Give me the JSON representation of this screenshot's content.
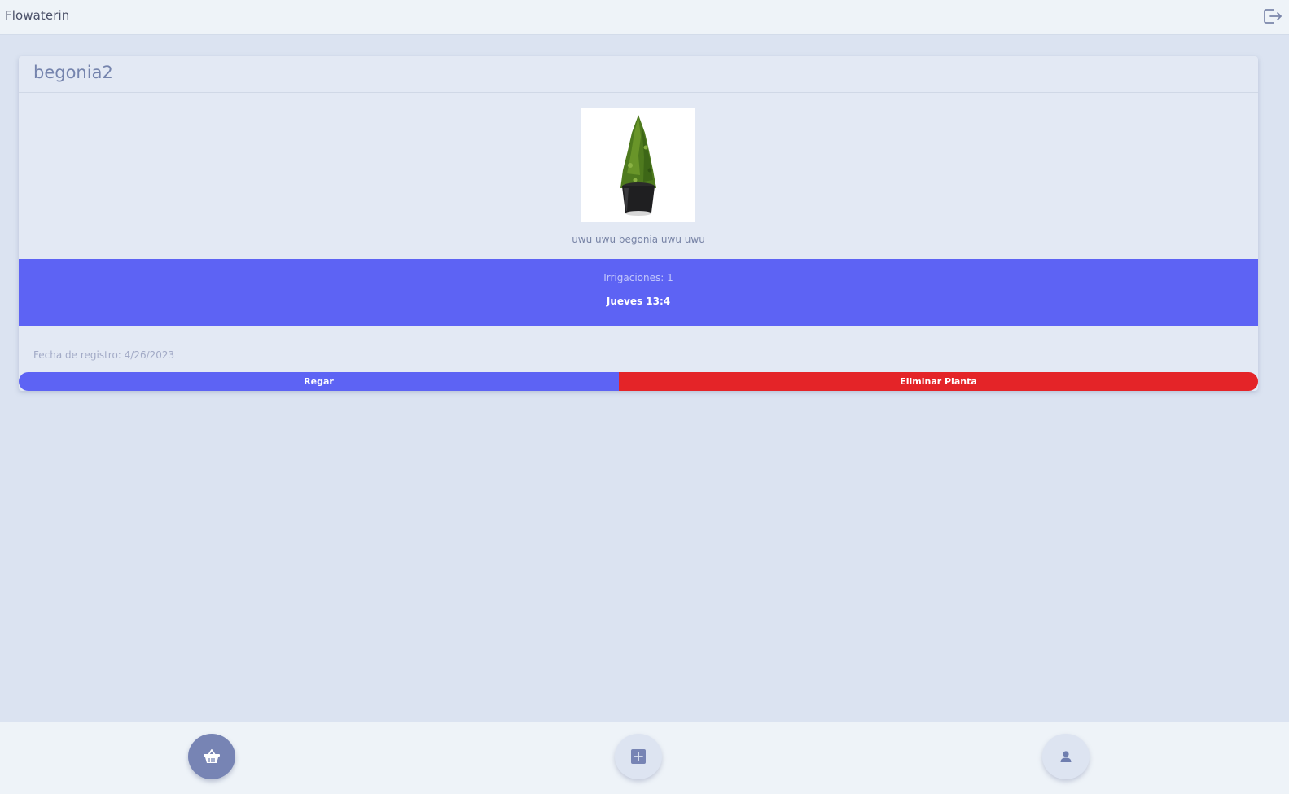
{
  "app": {
    "title": "Flowaterin",
    "logout_icon": "logout-icon"
  },
  "plant": {
    "name": "begonia2",
    "description": "uwu uwu begonia uwu uwu",
    "image_icon": "potted-plant-photo"
  },
  "irrigation": {
    "count_label": "Irrigaciones: 1",
    "last_time": "Jueves 13:4"
  },
  "registration": {
    "date_label": "Fecha de registro: 4/26/2023"
  },
  "actions": {
    "water_label": "Regar",
    "delete_label": "Eliminar Planta"
  },
  "bottom_nav": {
    "items": [
      {
        "icon": "basket-icon",
        "active": true
      },
      {
        "icon": "plus-square-icon",
        "active": false
      },
      {
        "icon": "user-icon",
        "active": false
      }
    ]
  },
  "colors": {
    "accent": "#5d63f4",
    "danger": "#e42428",
    "background": "#dbe3f1",
    "nav_active": "#7784b4"
  }
}
